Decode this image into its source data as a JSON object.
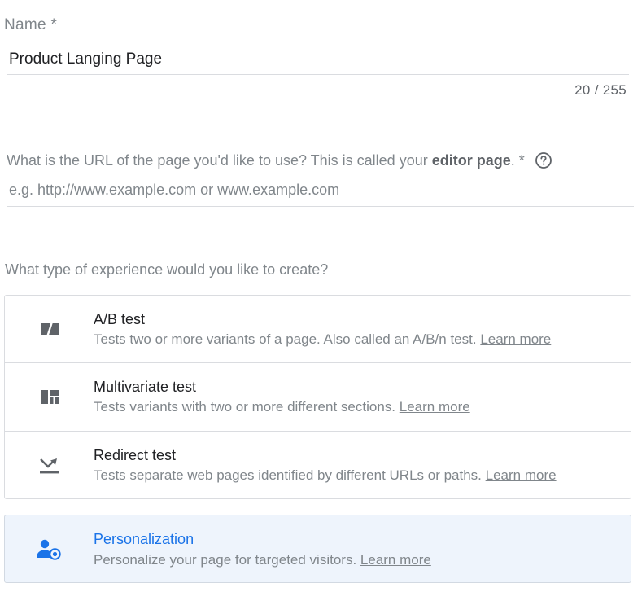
{
  "name_field": {
    "label": "Name *",
    "value": "Product Langing Page",
    "counter": "20 / 255"
  },
  "url_field": {
    "label_before": "What is the URL of the page you'd like to use? This is called your ",
    "label_bold": "editor page",
    "label_after": ". *",
    "placeholder": "e.g. http://www.example.com or www.example.com",
    "help_icon": "question-circle-icon"
  },
  "experience": {
    "question": "What type of experience would you like to create?",
    "options": [
      {
        "title": "A/B test",
        "description": "Tests two or more variants of a page. Also called an A/B/n test.",
        "link": "Learn more",
        "icon": "ab-test-icon"
      },
      {
        "title": "Multivariate test",
        "description": "Tests variants with two or more different sections.",
        "link": "Learn more",
        "icon": "multivariate-icon"
      },
      {
        "title": "Redirect test",
        "description": "Tests separate web pages identified by different URLs or paths.",
        "link": "Learn more",
        "icon": "redirect-icon"
      },
      {
        "title": "Personalization",
        "description": "Personalize your page for targeted visitors.",
        "link": "Learn more",
        "icon": "personalization-icon",
        "selected": true
      }
    ]
  },
  "colors": {
    "accent": "#1a73e8",
    "selected_background": "#eef4fc",
    "muted_text": "#80868b",
    "border": "#dadce0",
    "icon_gray": "#5f6368"
  }
}
